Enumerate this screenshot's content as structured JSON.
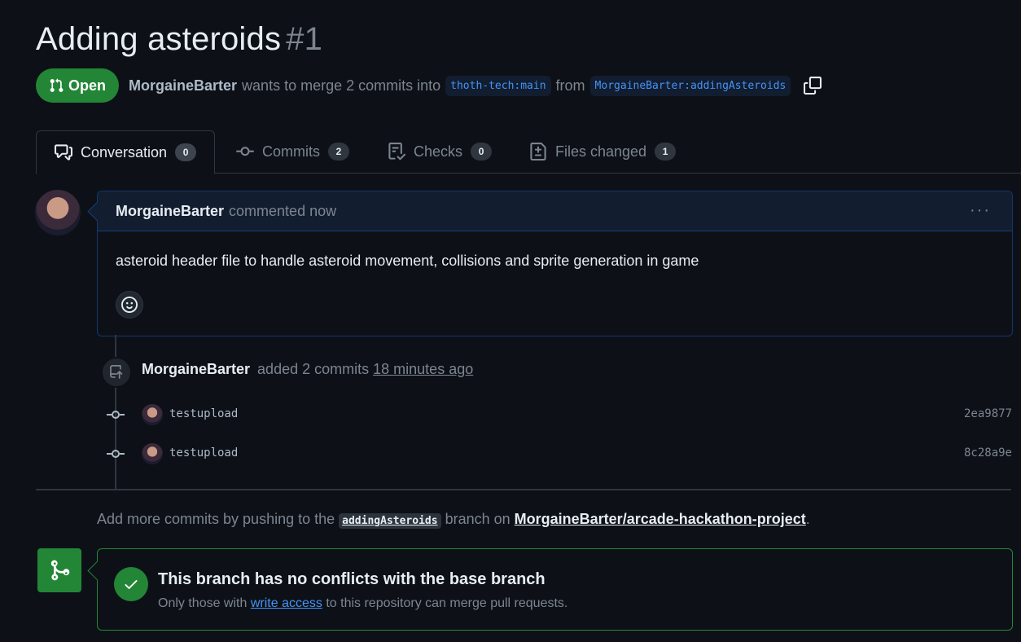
{
  "pr": {
    "title": "Adding asteroids",
    "number": "#1",
    "state": "Open",
    "author": "MorgaineBarter",
    "merge_text": "wants to merge 2 commits into",
    "base_branch": "thoth-tech:main",
    "from_text": "from",
    "head_branch": "MorgaineBarter:addingAsteroids"
  },
  "tabs": [
    {
      "label": "Conversation",
      "count": "0",
      "icon": "comment-discussion-icon"
    },
    {
      "label": "Commits",
      "count": "2",
      "icon": "git-commit-icon"
    },
    {
      "label": "Checks",
      "count": "0",
      "icon": "checklist-icon"
    },
    {
      "label": "Files changed",
      "count": "1",
      "icon": "file-diff-icon"
    }
  ],
  "comment": {
    "author": "MorgaineBarter",
    "action": "commented now",
    "body": "asteroid header file to handle asteroid movement, collisions and sprite generation in game",
    "menu": "···"
  },
  "event": {
    "author": "MorgaineBarter",
    "action": "added 2 commits",
    "time": "18 minutes ago"
  },
  "commits": [
    {
      "message": "testupload",
      "sha": "2ea9877"
    },
    {
      "message": "testupload",
      "sha": "8c28a9e"
    }
  ],
  "hint": {
    "prefix": "Add more commits by pushing to the",
    "branch": "addingAsteroids",
    "middle": "branch on",
    "repo": "MorgaineBarter/arcade-hackathon-project",
    "suffix": "."
  },
  "merge": {
    "title": "This branch has no conflicts with the base branch",
    "sub_prefix": "Only those with",
    "link": "write access",
    "sub_suffix": "to this repository can merge pull requests."
  },
  "colors": {
    "background": "#0d1117",
    "open_green": "#238636",
    "link_blue": "#4493f8",
    "muted": "#7d8590"
  }
}
